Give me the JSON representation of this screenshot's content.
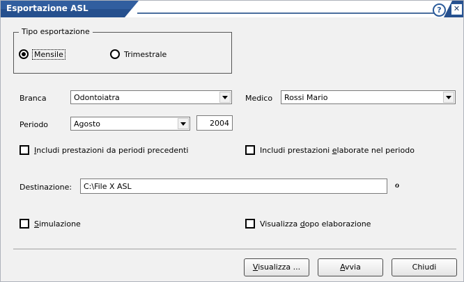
{
  "window": {
    "title": "Esportazione ASL",
    "help_glyph": "?",
    "close_glyph": "✕",
    "icons": [
      "help-icon",
      "close-icon"
    ],
    "accent": "#2a5a9a"
  },
  "tipo_esportazione": {
    "legend": "Tipo esportazione",
    "options": [
      {
        "label": "Mensile",
        "selected": true
      },
      {
        "label": "Trimestrale",
        "selected": false
      }
    ]
  },
  "branca": {
    "label": "Branca",
    "value": "Odontoiatra"
  },
  "medico": {
    "label": "Medico",
    "value": "Rossi Mario"
  },
  "periodo": {
    "label": "Periodo",
    "month": "Agosto",
    "year": "2004"
  },
  "checks": {
    "includi_precedenti": {
      "pre": "I",
      "rest": "ncludi prestazioni da periodi precedenti",
      "checked": false
    },
    "includi_elaborate": {
      "pre": "Includi prestazioni ",
      "ul": "e",
      "rest": "laborate nel periodo",
      "checked": false
    },
    "simulazione": {
      "pre": "S",
      "rest": "imulazione",
      "checked": false
    },
    "visualizza_dopo": {
      "pre": "Visualizza ",
      "ul": "d",
      "rest": "opo elaborazione",
      "checked": false
    }
  },
  "destinazione": {
    "label": "Destinazione:",
    "value": "C:\\File X ASL",
    "browse_icon": "folder-browse-icon",
    "browse_glyph": "ℴ"
  },
  "buttons": {
    "visualizza": {
      "ul": "V",
      "rest": "isualizza ..."
    },
    "avvia": {
      "ul": "A",
      "rest": "vvia"
    },
    "chiudi": {
      "label": "Chiudi"
    }
  }
}
